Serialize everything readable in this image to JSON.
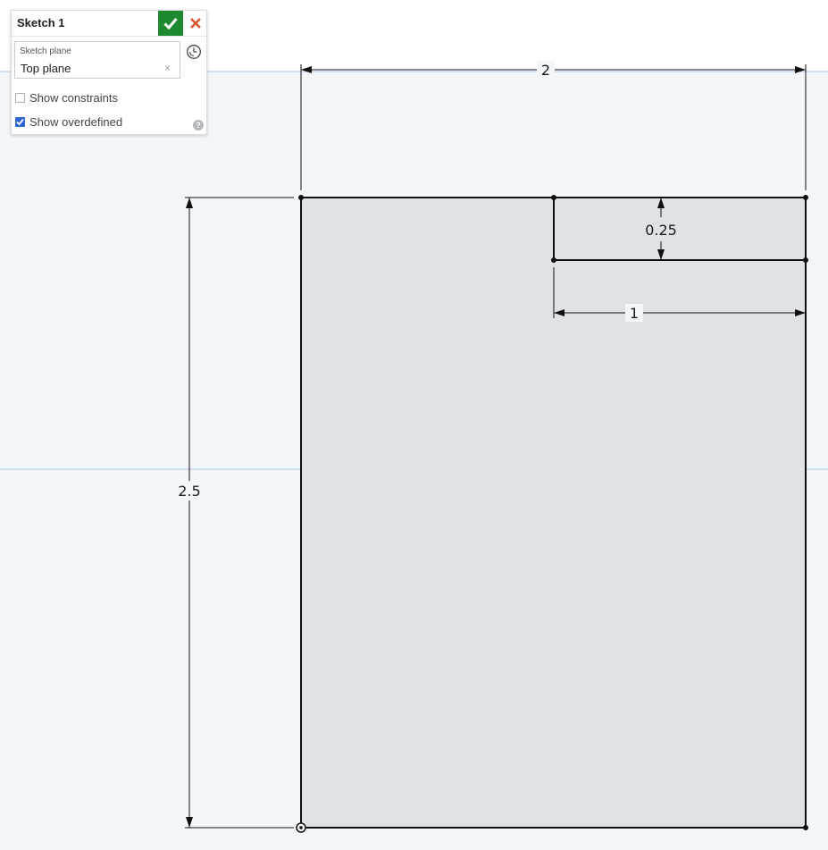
{
  "dialog": {
    "title": "Sketch 1",
    "plane_label": "Sketch plane",
    "plane_value": "Top plane",
    "show_constraints_label": "Show constraints",
    "show_constraints_checked": false,
    "show_overdefined_label": "Show overdefined",
    "show_overdefined_checked": true,
    "accept_icon": "checkmark-icon",
    "cancel_icon": "close-icon",
    "history_icon": "clock-icon",
    "help_icon": "help-icon",
    "help_glyph": "?",
    "clear_glyph": "×"
  },
  "sketch": {
    "dimensions": {
      "width": "2",
      "height": "2.5",
      "slot_width": "1",
      "slot_height": "0.25"
    }
  },
  "colors": {
    "grid_background": "#f4f7f9",
    "sketch_region": "#dfe2e6",
    "axis_line": "#a9c8e8",
    "geometry": "#111111",
    "accept_button": "#1e8a30",
    "cancel_icon": "#d9552b",
    "checkbox_checked": "#2e64d4"
  }
}
